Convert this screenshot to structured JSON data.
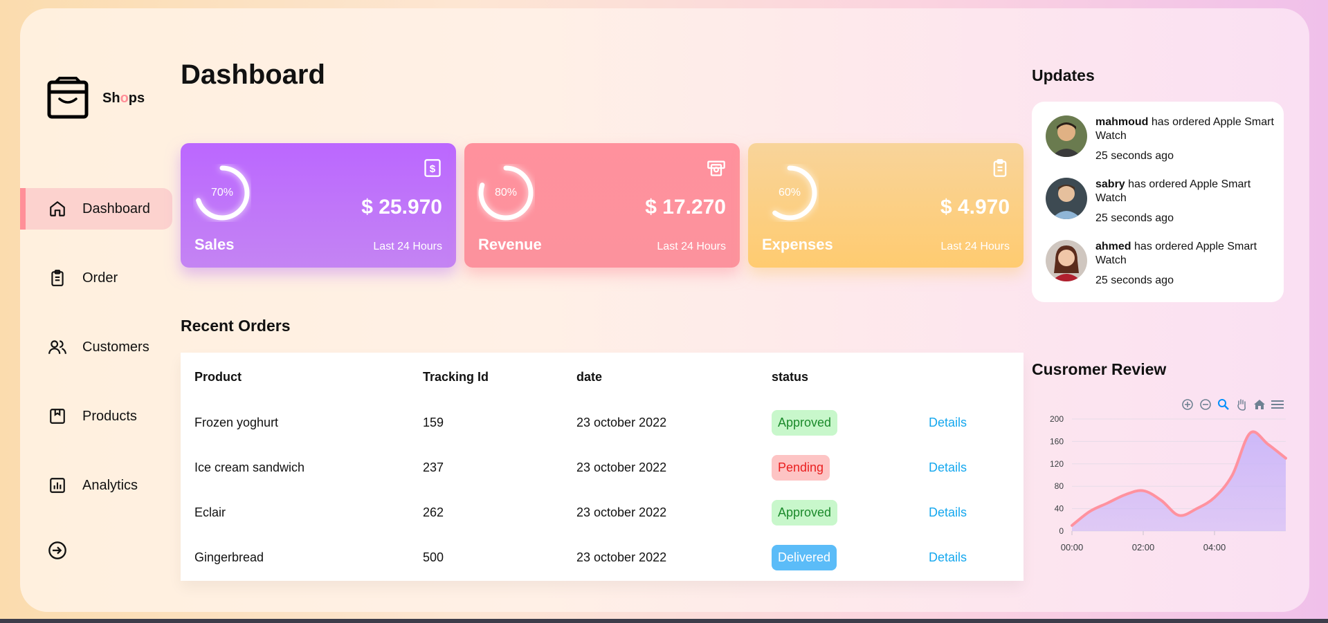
{
  "app": {
    "logo_prefix": "Sh",
    "logo_o": "o",
    "logo_suffix": "ps"
  },
  "sidebar": {
    "items": [
      {
        "label": "Dashboard",
        "icon": "home-icon",
        "active": true
      },
      {
        "label": "Order",
        "icon": "clipboard-icon",
        "active": false
      },
      {
        "label": "Customers",
        "icon": "users-icon",
        "active": false
      },
      {
        "label": "Products",
        "icon": "package-icon",
        "active": false
      },
      {
        "label": "Analytics",
        "icon": "analytics-icon",
        "active": false
      }
    ],
    "logout_icon": "sign-out-icon"
  },
  "main": {
    "title": "Dashboard",
    "cards": [
      {
        "label": "Sales",
        "value": "$ 25.970",
        "percent_text": "70%",
        "percent": 70,
        "sub": "Last 24 Hours",
        "icon": "dollar-icon",
        "color": "#bb67ff"
      },
      {
        "label": "Revenue",
        "value": "$ 17.270",
        "percent_text": "80%",
        "percent": 80,
        "sub": "Last 24 Hours",
        "icon": "money-bill-icon",
        "color": "#ff919d"
      },
      {
        "label": "Expenses",
        "value": "$ 4.970",
        "percent_text": "60%",
        "percent": 60,
        "sub": "Last 24 Hours",
        "icon": "clipboard-icon",
        "color": "#ffcb70"
      }
    ],
    "recent_orders": {
      "title": "Recent Orders",
      "headers": {
        "product": "Product",
        "tracking": "Tracking Id",
        "date": "date",
        "status": "status"
      },
      "rows": [
        {
          "product": "Frozen yoghurt",
          "tracking": "159",
          "date": "23 october 2022",
          "status": "Approved",
          "details": "Details"
        },
        {
          "product": "Ice cream sandwich",
          "tracking": "237",
          "date": "23 october 2022",
          "status": "Pending",
          "details": "Details"
        },
        {
          "product": "Eclair",
          "tracking": "262",
          "date": "23 october 2022",
          "status": "Approved",
          "details": "Details"
        },
        {
          "product": "Gingerbread",
          "tracking": "500",
          "date": "23 october 2022",
          "status": "Delivered",
          "details": "Details"
        }
      ]
    }
  },
  "updates": {
    "title": "Updates",
    "items": [
      {
        "name": "mahmoud",
        "text": " has ordered Apple Smart Watch",
        "time": "25 seconds ago"
      },
      {
        "name": "sabry",
        "text": " has ordered Apple Smart Watch",
        "time": "25 seconds ago"
      },
      {
        "name": "ahmed",
        "text": " has ordered Apple Smart Watch",
        "time": "25 seconds ago"
      }
    ]
  },
  "review": {
    "title": "Cusromer Review",
    "toolbar": [
      "zoom-in-icon",
      "zoom-out-icon",
      "magnify-icon",
      "pan-hand-icon",
      "home-reset-icon",
      "menu-icon"
    ]
  },
  "chart_data": {
    "type": "area",
    "x": [
      "00:00",
      "00:30",
      "01:00",
      "01:30",
      "02:00",
      "02:30",
      "03:00",
      "03:30",
      "04:00",
      "04:30",
      "05:00",
      "05:30",
      "06:00"
    ],
    "x_tick_labels": [
      "00:00",
      "02:00",
      "04:00"
    ],
    "series": [
      {
        "values": [
          10,
          35,
          50,
          65,
          72,
          55,
          28,
          40,
          60,
          100,
          175,
          155,
          130
        ]
      }
    ],
    "y_ticks": [
      0,
      40,
      80,
      120,
      160,
      200
    ],
    "ylim": [
      0,
      200
    ],
    "line_color": "#ff929f",
    "fill_color": "#c8b4f9",
    "grid": true
  }
}
